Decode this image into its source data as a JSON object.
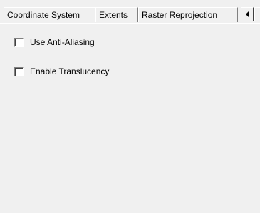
{
  "tabs": [
    {
      "label": "Coordinate System"
    },
    {
      "label": "Extents"
    },
    {
      "label": "Raster Reprojection"
    }
  ],
  "tab_scroll": {
    "left_icon": "triangle-left-icon"
  },
  "options": {
    "anti_aliasing": {
      "label": "Use Anti-Aliasing",
      "checked": false
    },
    "translucency": {
      "label": "Enable Translucency",
      "checked": false
    }
  }
}
